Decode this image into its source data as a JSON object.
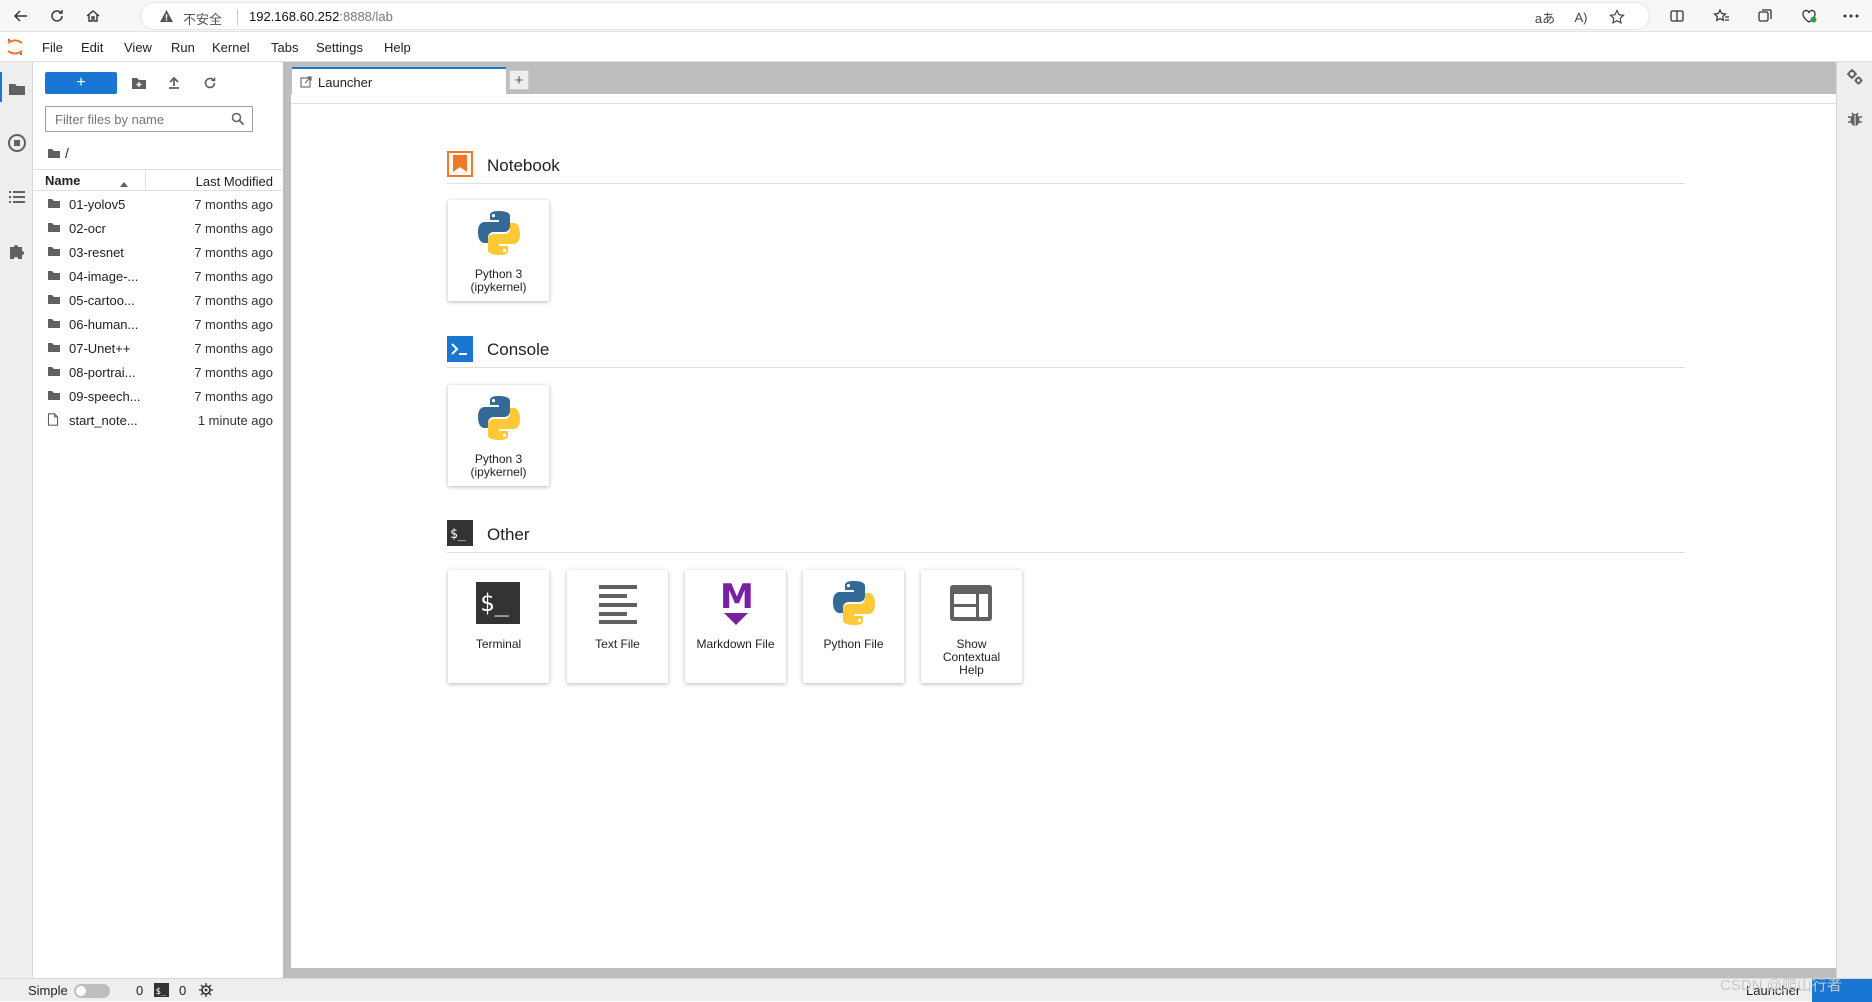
{
  "browser": {
    "insecure_label": "不安全",
    "url_host": "192.168.60.252",
    "url_rest": ":8888/lab"
  },
  "menubar": {
    "items": [
      "File",
      "Edit",
      "View",
      "Run",
      "Kernel",
      "Tabs",
      "Settings",
      "Help"
    ]
  },
  "filebrowser": {
    "new_button_label": "+",
    "filter_placeholder": "Filter files by name",
    "breadcrumb": "/",
    "column_name": "Name",
    "column_modified": "Last Modified",
    "files": [
      {
        "name": "01-yolov5",
        "modified": "7 months ago",
        "type": "folder"
      },
      {
        "name": "02-ocr",
        "modified": "7 months ago",
        "type": "folder"
      },
      {
        "name": "03-resnet",
        "modified": "7 months ago",
        "type": "folder"
      },
      {
        "name": "04-image-...",
        "modified": "7 months ago",
        "type": "folder"
      },
      {
        "name": "05-cartoo...",
        "modified": "7 months ago",
        "type": "folder"
      },
      {
        "name": "06-human...",
        "modified": "7 months ago",
        "type": "folder"
      },
      {
        "name": "07-Unet++",
        "modified": "7 months ago",
        "type": "folder"
      },
      {
        "name": "08-portrai...",
        "modified": "7 months ago",
        "type": "folder"
      },
      {
        "name": "09-speech...",
        "modified": "7 months ago",
        "type": "folder"
      },
      {
        "name": "start_note...",
        "modified": "1 minute ago",
        "type": "file"
      }
    ]
  },
  "tabs": {
    "active_label": "Launcher",
    "add_label": "+"
  },
  "launcher": {
    "notebook": {
      "title": "Notebook",
      "card": {
        "line1": "Python 3",
        "line2": "(ipykernel)"
      }
    },
    "console": {
      "title": "Console",
      "card": {
        "line1": "Python 3",
        "line2": "(ipykernel)"
      }
    },
    "other": {
      "title": "Other",
      "terminal": "Terminal",
      "text_file": "Text File",
      "markdown_file": "Markdown File",
      "python_file": "Python File",
      "help": {
        "line1": "Show",
        "line2": "Contextual",
        "line3": "Help"
      }
    }
  },
  "statusbar": {
    "simple_label": "Simple",
    "kernels_count": "0",
    "terminals_count": "0",
    "mode_label": "Launcher",
    "watermark": "CSDN @爬山行者"
  },
  "colors": {
    "accent": "#1976d2",
    "notebook_orange": "#f37726",
    "markdown_purple": "#7b1fa2",
    "python_blue": "#366a96",
    "python_yellow": "#ffc836"
  }
}
